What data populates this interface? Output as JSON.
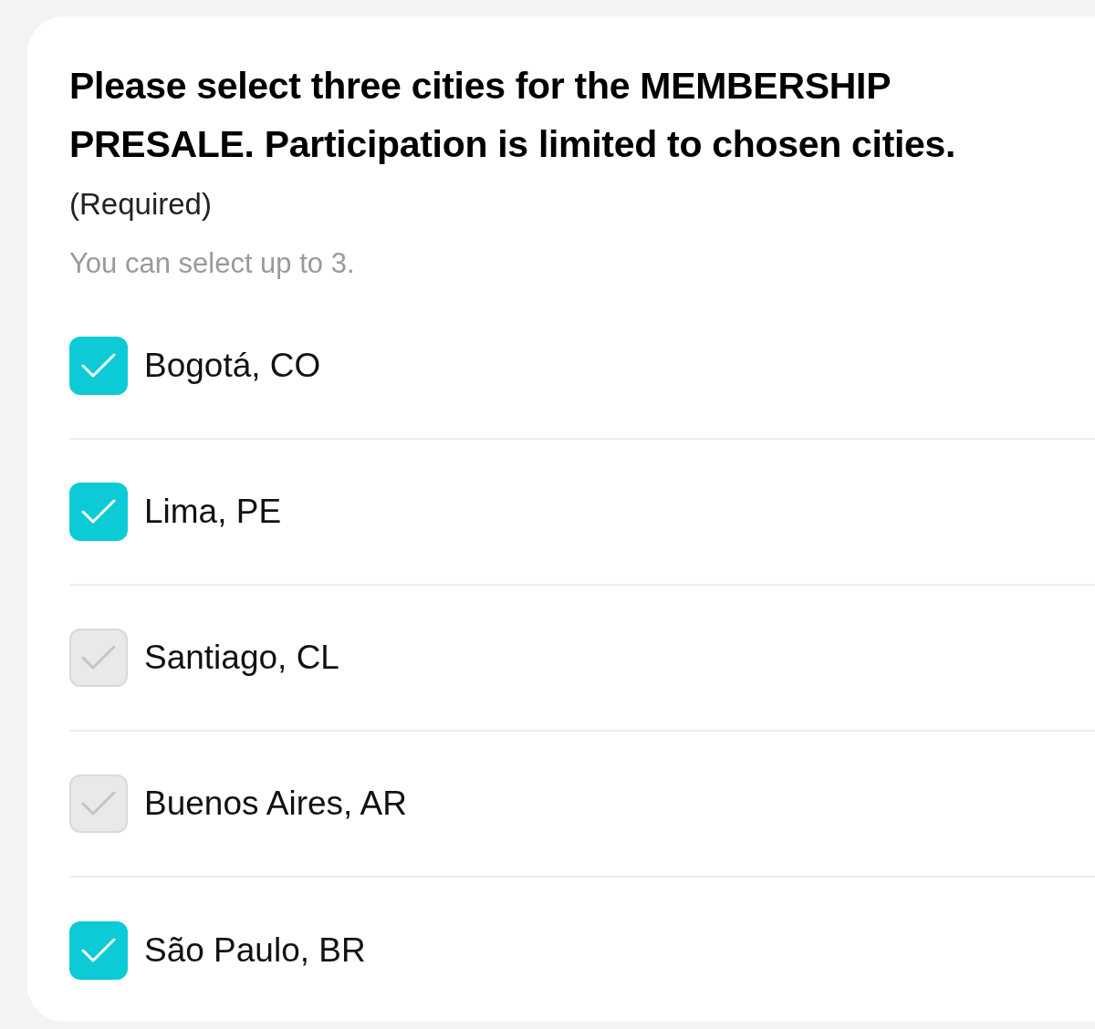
{
  "question": {
    "title": "Please select three cities for the MEMBERSHIP PRESALE. Participation is limited to chosen cities.",
    "required": "(Required)",
    "hint": "You can select up to 3."
  },
  "options": [
    {
      "label": "Bogotá, CO",
      "checked": true
    },
    {
      "label": "Lima, PE",
      "checked": true
    },
    {
      "label": "Santiago, CL",
      "checked": false
    },
    {
      "label": "Buenos Aires, AR",
      "checked": false
    },
    {
      "label": "São Paulo, BR",
      "checked": true
    }
  ]
}
